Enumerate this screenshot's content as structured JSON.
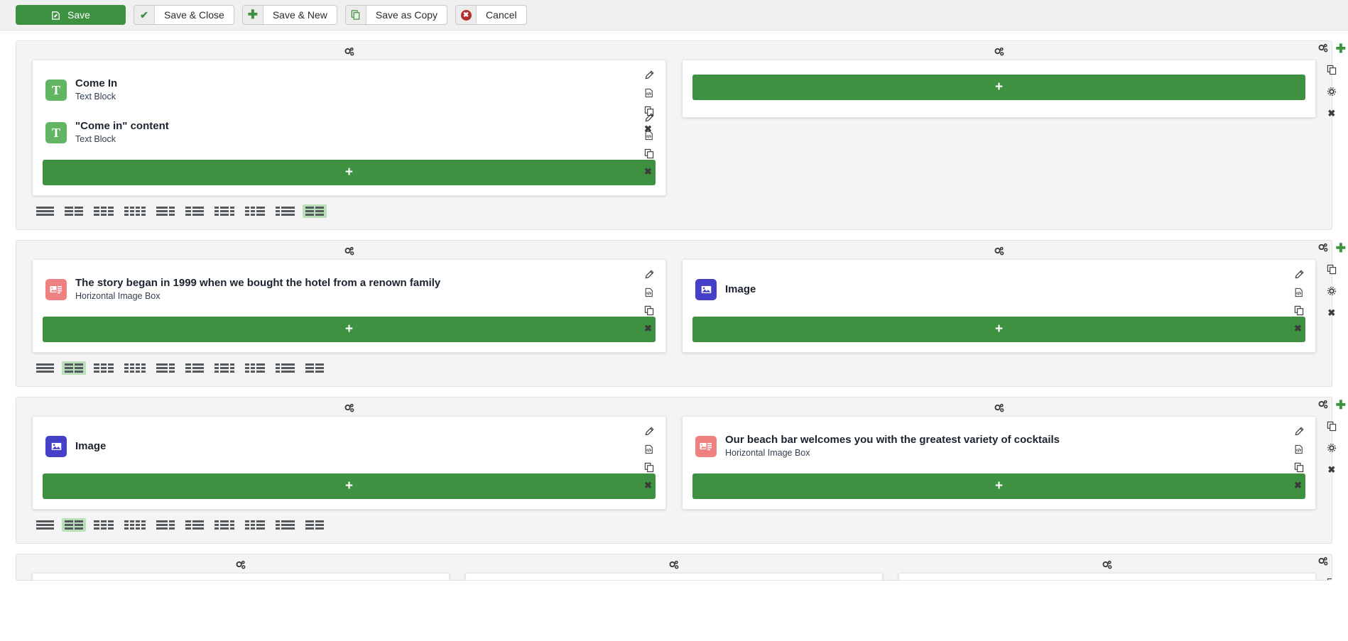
{
  "toolbar": {
    "buttons": [
      {
        "label": "Save",
        "icon": "save-icon",
        "name": "save-button",
        "primary": true
      },
      {
        "label": "Save & Close",
        "icon": "check-icon",
        "name": "save-close-button",
        "primary": false
      },
      {
        "label": "Save & New",
        "icon": "plus-icon",
        "name": "save-new-button",
        "primary": false
      },
      {
        "label": "Save as Copy",
        "icon": "copy-icon",
        "name": "save-copy-button",
        "primary": false
      },
      {
        "label": "Cancel",
        "icon": "cancel-icon",
        "name": "cancel-button",
        "primary": false
      }
    ]
  },
  "colors": {
    "accent_green": "#3f9142",
    "layout_active": "#b9e0b9",
    "text_addon": "#62b563",
    "image_addon": "#4540c8",
    "image_box_addon": "#ef8080",
    "toolbar_bg": "#f0f0f0",
    "row_bg": "#f4f4f4"
  },
  "labels": {
    "add_button": "+",
    "row_settings": "row-settings",
    "column_settings": "column-settings"
  },
  "icons": {
    "row_gear": "gears-icon",
    "rail_plus": "plus-icon",
    "rail_copy": "duplicate-icon",
    "rail_gear": "gear-icon",
    "rail_close": "close-icon",
    "addon_edit": "pencil-icon",
    "addon_code": "code-file-icon",
    "addon_copy": "duplicate-icon",
    "addon_delete": "close-icon"
  },
  "layout_options": [
    {
      "name": "layout-1-col",
      "segments": [
        1
      ]
    },
    {
      "name": "layout-2-col",
      "segments": [
        1,
        1
      ]
    },
    {
      "name": "layout-3-col",
      "segments": [
        1,
        1,
        1
      ]
    },
    {
      "name": "layout-4-col",
      "segments": [
        1,
        1,
        1,
        1
      ]
    },
    {
      "name": "layout-2-1",
      "segments": [
        2,
        1
      ]
    },
    {
      "name": "layout-1-2",
      "segments": [
        1,
        2
      ]
    },
    {
      "name": "layout-1-2-1",
      "segments": [
        1,
        2,
        1
      ]
    },
    {
      "name": "layout-1-1-2",
      "segments": [
        1,
        1,
        2
      ]
    },
    {
      "name": "layout-1-3",
      "segments": [
        1,
        3
      ]
    },
    {
      "name": "layout-2-2",
      "segments": [
        2,
        2
      ]
    }
  ],
  "rows": [
    {
      "name": "row-1",
      "active_layout": 9,
      "columns": [
        {
          "name": "column-1-1",
          "addons": [
            {
              "title": "Come In",
              "type": "Text Block",
              "icon": "text-block-icon",
              "icon_class": "text",
              "glyph": "T"
            },
            {
              "title": "\"Come in\" content",
              "type": "Text Block",
              "icon": "text-block-icon",
              "icon_class": "text",
              "glyph": "T"
            }
          ]
        },
        {
          "name": "column-1-2",
          "addons": []
        }
      ]
    },
    {
      "name": "row-2",
      "active_layout": 1,
      "columns": [
        {
          "name": "column-2-1",
          "addons": [
            {
              "title": "The story began in 1999 when we bought the hotel from a renown family",
              "type": "Horizontal Image Box",
              "icon": "horizontal-image-box-icon",
              "icon_class": "hib",
              "glyph": ""
            }
          ]
        },
        {
          "name": "column-2-2",
          "addons": [
            {
              "title": "Image",
              "type": "",
              "icon": "image-icon",
              "icon_class": "image",
              "glyph": ""
            }
          ]
        }
      ]
    },
    {
      "name": "row-3",
      "active_layout": 1,
      "columns": [
        {
          "name": "column-3-1",
          "addons": [
            {
              "title": "Image",
              "type": "",
              "icon": "image-icon",
              "icon_class": "image",
              "glyph": ""
            }
          ]
        },
        {
          "name": "column-3-2",
          "addons": [
            {
              "title": "Our beach bar welcomes you with the greatest variety of cocktails",
              "type": "Horizontal Image Box",
              "icon": "horizontal-image-box-icon",
              "icon_class": "hib",
              "glyph": ""
            }
          ]
        }
      ]
    },
    {
      "name": "row-4",
      "active_layout": 2,
      "partial": true,
      "columns": [
        {
          "name": "column-4-1",
          "addons": []
        },
        {
          "name": "column-4-2",
          "addons": []
        },
        {
          "name": "column-4-3",
          "addons": []
        }
      ]
    }
  ]
}
